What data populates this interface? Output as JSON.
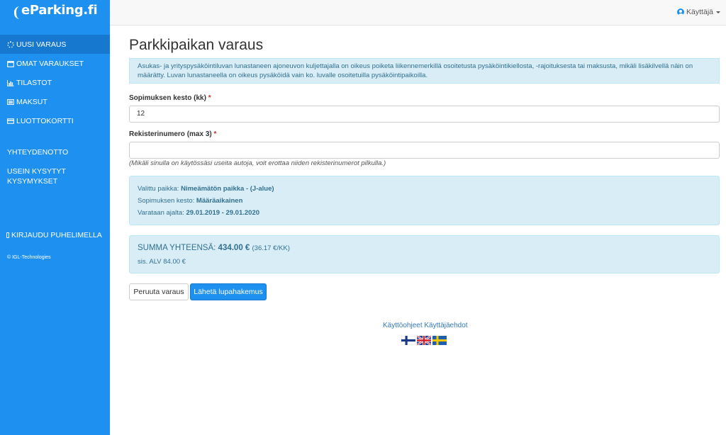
{
  "brand": {
    "name": "eParking.fi"
  },
  "sidebar": {
    "items": [
      {
        "label": "UUSI VARAUS",
        "icon": "spinner-icon"
      },
      {
        "label": "OMAT VARAUKSET",
        "icon": "calendar-icon"
      },
      {
        "label": "TILASTOT",
        "icon": "bar-chart-icon"
      },
      {
        "label": "MAKSUT",
        "icon": "list-icon"
      },
      {
        "label": "LUOTTOKORTTI",
        "icon": "credit-card-icon"
      }
    ],
    "contact": "YHTEYDENOTTO",
    "faq_line1": "USEIN KYSYTYT",
    "faq_line2": "KYSYMYKSET",
    "phone_login": "KIRJAUDU PUHELIMELLA",
    "copyright": "© IGL-Technologies"
  },
  "topbar": {
    "user_label": "Käyttäjä"
  },
  "main": {
    "title": "Parkkipaikan varaus",
    "info_line1": "Asukas- ja yrityspysäköintiluvan lunastaneen ajoneuvon kuljettajalla on oikeus poiketa liikennemerkillä osoitetusta pysäköintikiellosta, -rajoituksesta tai maksusta, mikäli lisäkilvellä näin on",
    "info_line2": "määrätty. Luvan lunastaneella on oikeus pysäköidä vain ko. luvalle osoitetuilla pysäköintipaikoilla.",
    "duration_label": "Sopimuksen kesto (kk)",
    "duration_value": "12",
    "plates_label": "Rekisterinumero (max 3)",
    "plates_value": "",
    "plates_help": "(Mikäli sinulla on käytössäsi useita autoja, voit erottaa niiden rekisterinumerot pilkulla.)",
    "required_mark": "*",
    "summary": {
      "place_label": "Valittu paikka:",
      "place_value": "Nimeämätön paikka - (J-alue)",
      "contract_label": "Sopimuksen kesto:",
      "contract_value": "Määräaikainen",
      "period_label": "Varataan ajalta:",
      "period_value": "29.01.2019 - 29.01.2020"
    },
    "total": {
      "label": "SUMMA YHTEENSÄ:",
      "amount": "434.00 €",
      "per_month": "(36.17 €/KK)",
      "vat": "sis. ALV 84.00 €"
    },
    "cancel_button": "Peruuta varaus",
    "submit_button": "Lähetä lupahakemus",
    "footer_link1": "Käyttöohjeet",
    "footer_link2": "Käyttäjäehdot"
  },
  "colors": {
    "sidebar": "#1e90f0",
    "sidebar_active": "#1778d0",
    "info_bg": "#d9edf7",
    "info_text": "#31708f"
  }
}
